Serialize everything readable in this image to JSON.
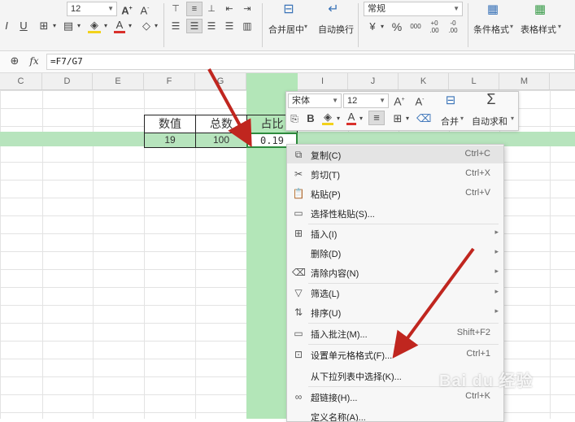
{
  "ribbon": {
    "font_size": "12",
    "number_format": "常规",
    "merge_center": "合并居中",
    "wrap_text": "自动换行",
    "conditional_format": "条件格式",
    "table_style": "表格样式",
    "bold_a": "A",
    "font_color_a": "A",
    "italic": "I",
    "underline": "U",
    "percent": "%",
    "thousands": "000",
    "dec_inc": "+0 .00",
    "dec_dec": "-0 .00"
  },
  "formula_bar": {
    "fx": "fx",
    "formula": "=F7/G7"
  },
  "columns": [
    "C",
    "D",
    "E",
    "F",
    "G",
    "H",
    "I",
    "J",
    "K",
    "L",
    "M"
  ],
  "table": {
    "headers": [
      "数值",
      "总数",
      "占比"
    ],
    "row": [
      "19",
      "100",
      "0.19"
    ]
  },
  "mini_toolbar": {
    "font_name": "宋体",
    "font_size": "12",
    "merge": "合并",
    "autosum": "自动求和",
    "bold": "B",
    "font_color": "A",
    "grow_font": "A⁺",
    "shrink_font": "A⁻"
  },
  "context_menu": [
    {
      "label": "复制(C)",
      "shortcut": "Ctrl+C",
      "icon": "copy-icon"
    },
    {
      "label": "剪切(T)",
      "shortcut": "Ctrl+X",
      "icon": "scissors-icon"
    },
    {
      "label": "粘贴(P)",
      "shortcut": "Ctrl+V",
      "icon": "paste-icon"
    },
    {
      "label": "选择性粘贴(S)...",
      "shortcut": "",
      "icon": "paste-special-icon"
    },
    {
      "label": "插入(I)",
      "shortcut": "",
      "icon": "insert-icon"
    },
    {
      "label": "删除(D)",
      "shortcut": "",
      "icon": ""
    },
    {
      "label": "清除内容(N)",
      "shortcut": "",
      "icon": "eraser-icon"
    },
    {
      "label": "筛选(L)",
      "shortcut": "",
      "icon": "filter-icon"
    },
    {
      "label": "排序(U)",
      "shortcut": "",
      "icon": "sort-icon"
    },
    {
      "label": "插入批注(M)...",
      "shortcut": "Shift+F2",
      "icon": "comment-icon"
    },
    {
      "label": "设置单元格格式(F)...",
      "shortcut": "Ctrl+1",
      "icon": "format-cells-icon"
    },
    {
      "label": "从下拉列表中选择(K)...",
      "shortcut": "",
      "icon": ""
    },
    {
      "label": "超链接(H)...",
      "shortcut": "Ctrl+K",
      "icon": "link-icon"
    },
    {
      "label": "定义名称(A)...",
      "shortcut": "",
      "icon": ""
    }
  ],
  "watermark": "Bai du 经验"
}
